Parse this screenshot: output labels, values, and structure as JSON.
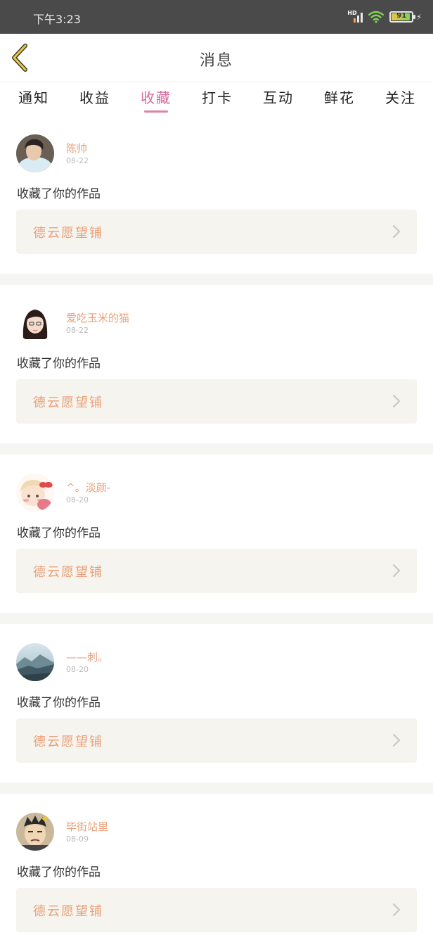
{
  "status_bar": {
    "time": "下午3:23",
    "battery_level": "91",
    "network": "HD"
  },
  "header": {
    "title": "消息"
  },
  "tabs": [
    {
      "label": "通知",
      "active": false
    },
    {
      "label": "收益",
      "active": false
    },
    {
      "label": "收藏",
      "active": true
    },
    {
      "label": "打卡",
      "active": false
    },
    {
      "label": "互动",
      "active": false
    },
    {
      "label": "鲜花",
      "active": false
    },
    {
      "label": "关注",
      "active": false
    }
  ],
  "notifications": [
    {
      "username": "陈帅",
      "date": "08-22",
      "message": "收藏了你的作品",
      "work_title": "德云愿望铺"
    },
    {
      "username": "爱吃玉米的猫",
      "date": "08-22",
      "message": "收藏了你的作品",
      "work_title": "德云愿望铺"
    },
    {
      "username": "^。淡颜-",
      "date": "08-20",
      "message": "收藏了你的作品",
      "work_title": "德云愿望铺"
    },
    {
      "username": "——刺。",
      "date": "08-20",
      "message": "收藏了你的作品",
      "work_title": "德云愿望铺"
    },
    {
      "username": "毕街站里",
      "date": "08-09",
      "message": "收藏了你的作品",
      "work_title": "德云愿望铺"
    }
  ],
  "colors": {
    "accent_pink": "#d8679c",
    "accent_orange": "#eaa07a",
    "status_bar_bg": "#4a4a4a"
  }
}
